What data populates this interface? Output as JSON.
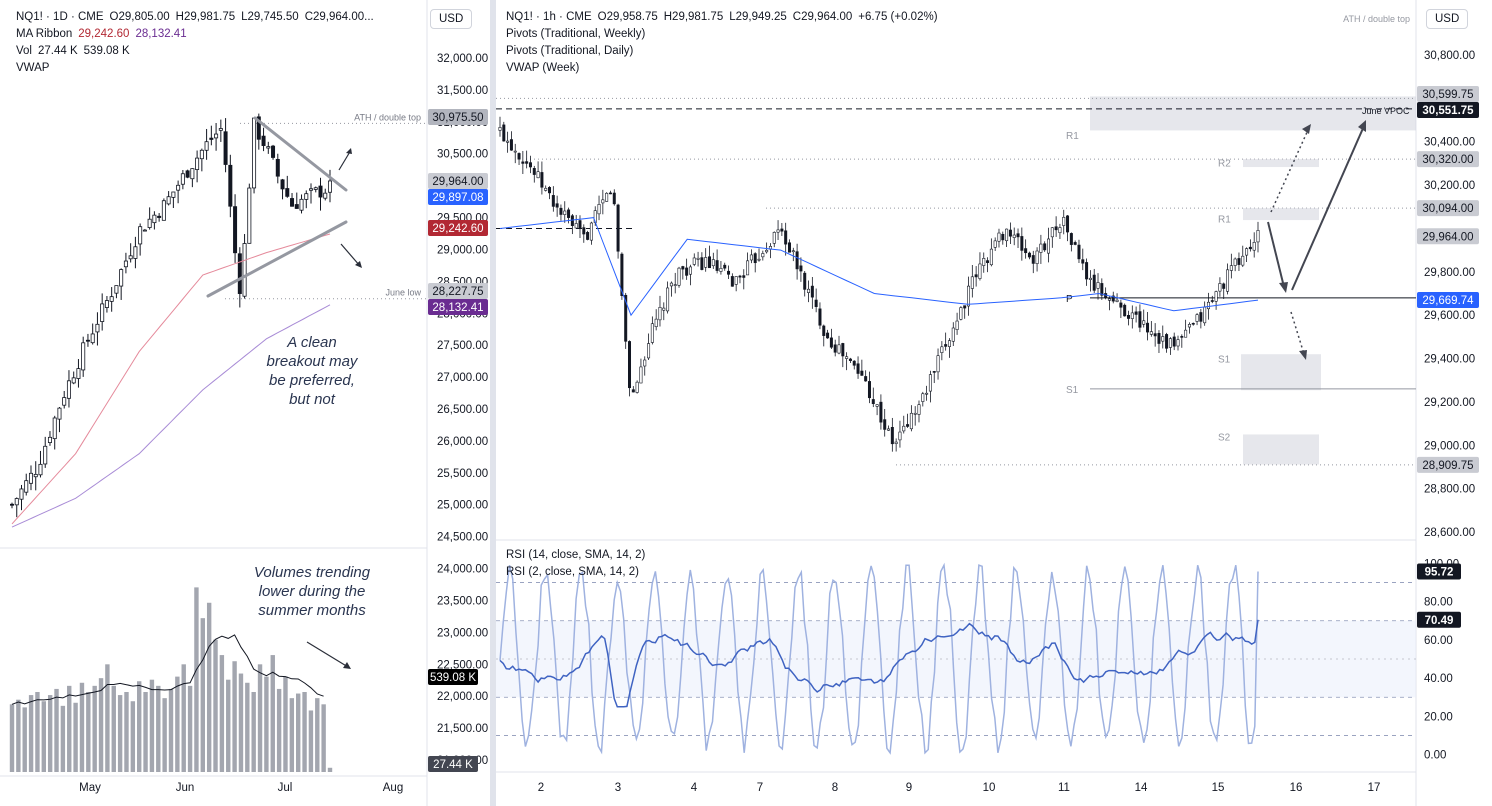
{
  "left": {
    "legend": {
      "symbol_line": "NQ1! · 1D · CME",
      "ohlc": [
        "O29,805.00",
        "H29,981.75",
        "L29,745.50",
        "C29,964.00..."
      ],
      "ma_label": "MA Ribbon",
      "ma_values": [
        "29,242.60",
        "28,132.41"
      ],
      "vol_label": "Vol",
      "vol_values": [
        "27.44 K",
        "539.08 K"
      ],
      "vwap_label": "VWAP"
    },
    "currency": "USD",
    "annotations": {
      "ath": "ATH / double top",
      "june_low": "June low",
      "breakout": [
        "A clean",
        "breakout may",
        "be preferred,",
        "but not"
      ],
      "volumes": [
        "Volumes trending",
        "lower during the",
        "summer months"
      ]
    },
    "x_ticks": [
      "May",
      "Jun",
      "Jul",
      "Aug"
    ],
    "price_ticks": [
      "32,000.00",
      "31,500.00",
      "31,000.00",
      "30,500.00",
      "30,000.00",
      "29,500.00",
      "29,000.00",
      "28,500.00",
      "28,000.00",
      "27,500.00",
      "27,000.00",
      "26,500.00",
      "26,000.00",
      "25,500.00",
      "25,000.00",
      "24,500.00",
      "24,000.00",
      "23,500.00",
      "23,000.00",
      "22,500.00",
      "22,000.00",
      "21,500.00",
      "21,000.00"
    ],
    "price_badges": [
      {
        "text": "30,975.50",
        "bg": "#b2b5be",
        "fg": "#131722",
        "v": 30975.5
      },
      {
        "text": "29,964.00",
        "bg": "#c9cbd2",
        "fg": "#131722",
        "v": 29964
      },
      {
        "text": "29,897.08",
        "bg": "#2962ff",
        "fg": "#ffffff",
        "v": 29897.08
      },
      {
        "text": "29,242.60",
        "bg": "#b22833",
        "fg": "#ffffff",
        "v": 29242.6
      },
      {
        "text": "28,227.75",
        "bg": "#c9cbd2",
        "fg": "#131722",
        "v": 28227.75
      },
      {
        "text": "28,132.41",
        "bg": "#6a2c91",
        "fg": "#ffffff",
        "v": 28132.41
      }
    ],
    "volume_badges": [
      {
        "text": "539.08 K",
        "bg": "#000000",
        "fg": "#ffffff"
      },
      {
        "text": "27.44 K",
        "bg": "#434651",
        "fg": "#ffffff"
      }
    ]
  },
  "right": {
    "legend": {
      "symbol_line": "NQ1! · 1h · CME",
      "ohlc": [
        "O29,958.75",
        "H29,981.75",
        "L29,949.25",
        "C29,964.00",
        "+6.75 (+0.02%)"
      ],
      "lines": [
        "Pivots (Traditional, Weekly)",
        "Pivots (Traditional, Daily)",
        "VWAP (Week)"
      ]
    },
    "currency": "USD",
    "annotations": {
      "ath": "ATH / double top",
      "june_vpoc": "June VPOC",
      "pivot_labels": [
        {
          "text": "R1",
          "v": 30430,
          "pos": "weekly"
        },
        {
          "text": "R2",
          "v": 30305,
          "pos": "daily"
        },
        {
          "text": "R1",
          "v": 30045,
          "pos": "daily"
        },
        {
          "text": "P",
          "v": 29680,
          "pos": "weekly"
        },
        {
          "text": "S1",
          "v": 29400,
          "pos": "daily"
        },
        {
          "text": "S1",
          "v": 29260,
          "pos": "weekly"
        },
        {
          "text": "S2",
          "v": 29040,
          "pos": "daily"
        }
      ]
    },
    "x_ticks": [
      "2",
      "3",
      "4",
      "7",
      "8",
      "9",
      "10",
      "11",
      "14",
      "15",
      "16",
      "17"
    ],
    "price_ticks": [
      "30,800.00",
      "30,400.00",
      "30,200.00",
      "29,800.00",
      "29,600.00",
      "29,400.00",
      "29,200.00",
      "29,000.00",
      "28,800.00",
      "28,600.00"
    ],
    "price_badges": [
      {
        "text": "30,599.75",
        "bg": "#c9cbd2",
        "fg": "#131722",
        "v": 30599.75
      },
      {
        "text": "30,551.75",
        "bg": "#131722",
        "fg": "#ffffff",
        "v": 30551.75
      },
      {
        "text": "30,320.00",
        "bg": "#c9cbd2",
        "fg": "#131722",
        "v": 30320
      },
      {
        "text": "30,094.00",
        "bg": "#c9cbd2",
        "fg": "#131722",
        "v": 30094
      },
      {
        "text": "29,964.00",
        "bg": "#c9cbd2",
        "fg": "#131722",
        "v": 29964
      },
      {
        "text": "29,669.74",
        "bg": "#2962ff",
        "fg": "#ffffff",
        "v": 29669.74
      },
      {
        "text": "28,909.75",
        "bg": "#c9cbd2",
        "fg": "#131722",
        "v": 28909.75
      }
    ],
    "rsi": {
      "legend": [
        "RSI (14, close, SMA, 14, 2)",
        "RSI (2, close, SMA, 14, 2)"
      ],
      "ticks": [
        "100.00",
        "80.00",
        "60.00",
        "40.00",
        "20.00",
        "0.00"
      ],
      "badges": [
        {
          "text": "95.72",
          "bg": "#131722",
          "fg": "#ffffff",
          "v": 95.72
        },
        {
          "text": "70.49",
          "bg": "#131722",
          "fg": "#ffffff",
          "v": 70.49
        }
      ]
    }
  },
  "chart_data": [
    {
      "type": "candlestick",
      "panel": "NQ1! 1D",
      "ylim": [
        20800,
        32400
      ],
      "x_range": [
        "Apr",
        "Aug"
      ],
      "key_levels": {
        "ath": 30975.5,
        "june_low": 28227.75,
        "last": 29964
      },
      "close_path": [
        [
          0,
          25000
        ],
        [
          8,
          25600
        ],
        [
          16,
          26700
        ],
        [
          24,
          27600
        ],
        [
          32,
          28400
        ],
        [
          40,
          29300
        ],
        [
          48,
          29700
        ],
        [
          56,
          30300
        ],
        [
          62,
          30700
        ],
        [
          66,
          30900
        ],
        [
          70,
          29000
        ],
        [
          72,
          28300
        ],
        [
          76,
          30950
        ],
        [
          80,
          30600
        ],
        [
          84,
          30100
        ],
        [
          88,
          29700
        ],
        [
          92,
          29800
        ],
        [
          96,
          29900
        ],
        [
          100,
          29964
        ]
      ],
      "ma_fast_path": [
        [
          0,
          24700
        ],
        [
          20,
          25800
        ],
        [
          40,
          27400
        ],
        [
          60,
          28600
        ],
        [
          80,
          28950
        ],
        [
          100,
          29242.6
        ]
      ],
      "ma_slow_path": [
        [
          0,
          24650
        ],
        [
          20,
          25100
        ],
        [
          40,
          25800
        ],
        [
          60,
          26800
        ],
        [
          80,
          27600
        ],
        [
          100,
          28132.41
        ]
      ],
      "volume": {
        "unit": "K",
        "last": 27.44,
        "ma": 539.08,
        "bars": [
          440,
          470,
          420,
          500,
          520,
          460,
          500,
          540,
          430,
          560,
          450,
          580,
          520,
          560,
          610,
          700,
          560,
          500,
          520,
          460,
          590,
          520,
          600,
          560,
          480,
          540,
          620,
          700,
          560,
          1200,
          1000,
          1100,
          860,
          760,
          600,
          720,
          640,
          580,
          520,
          700,
          620,
          760,
          540,
          620,
          480,
          510,
          520,
          400,
          480,
          440,
          27.44
        ]
      }
    },
    {
      "type": "candlestick",
      "panel": "NQ1! 1h",
      "ylim": [
        28560,
        30900
      ],
      "key_levels": {
        "june_vpoc": 30551.75,
        "ath": 30599.75,
        "last": 29964,
        "vwap_week": 29669.74,
        "low": 28909.75,
        "resistance": 30320,
        "prior_high": 30094
      },
      "close_path": [
        [
          0,
          30450
        ],
        [
          3,
          30300
        ],
        [
          6,
          30100
        ],
        [
          9,
          29950
        ],
        [
          12,
          30200
        ],
        [
          14,
          29200
        ],
        [
          16,
          29500
        ],
        [
          19,
          29800
        ],
        [
          22,
          29850
        ],
        [
          25,
          29750
        ],
        [
          28,
          29900
        ],
        [
          30,
          30000
        ],
        [
          32,
          29800
        ],
        [
          35,
          29500
        ],
        [
          39,
          29300
        ],
        [
          42,
          29000
        ],
        [
          45,
          29200
        ],
        [
          48,
          29500
        ],
        [
          51,
          29800
        ],
        [
          54,
          30000
        ],
        [
          57,
          29850
        ],
        [
          60,
          30050
        ],
        [
          63,
          29750
        ],
        [
          66,
          29650
        ],
        [
          69,
          29550
        ],
        [
          72,
          29450
        ],
        [
          75,
          29600
        ],
        [
          78,
          29800
        ],
        [
          81,
          29964
        ]
      ],
      "vwap_path": [
        [
          0,
          30000
        ],
        [
          10,
          30050
        ],
        [
          14,
          29600
        ],
        [
          20,
          29950
        ],
        [
          30,
          29900
        ],
        [
          40,
          29700
        ],
        [
          50,
          29650
        ],
        [
          60,
          29680
        ],
        [
          64,
          29700
        ],
        [
          72,
          29620
        ],
        [
          81,
          29669.74
        ]
      ]
    },
    {
      "type": "line",
      "panel": "RSI",
      "ylim": [
        -8,
        108
      ],
      "series": [
        {
          "name": "RSI (14, close, SMA, 14, 2)",
          "last": 70.49
        },
        {
          "name": "RSI (2, close, SMA, 14, 2)",
          "last": 95.72
        }
      ]
    }
  ]
}
